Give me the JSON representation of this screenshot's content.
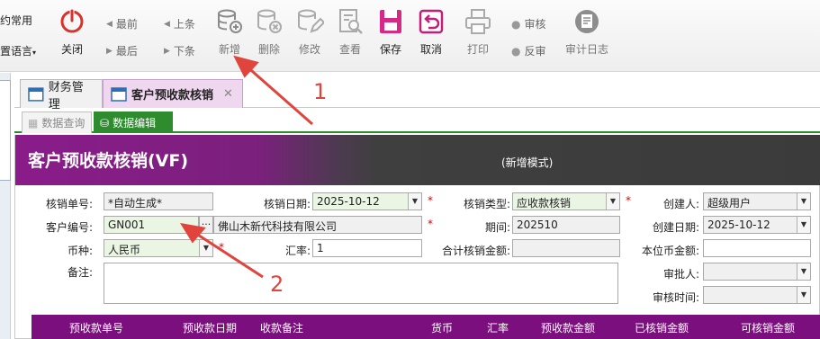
{
  "toolbar": {
    "left_line1": "约常用",
    "left_line2": "置语言",
    "left_line2_arrow": "▾",
    "close_label": "关闭",
    "first_label": "最前",
    "prev_label": "上条",
    "last_label": "最后",
    "next_label": "下条",
    "add_label": "新增",
    "delete_label": "删除",
    "edit_label": "修改",
    "view_label": "查看",
    "save_label": "保存",
    "cancel_label": "取消",
    "print_label": "打印",
    "audit_label": "审核",
    "unaudit_label": "反审",
    "auditlog_label": "审计日志"
  },
  "tabs": [
    {
      "label": "财务管理",
      "close": ""
    },
    {
      "label": "客户预收款核销",
      "close": "✕"
    }
  ],
  "subtabs": [
    {
      "label": "数据查询"
    },
    {
      "label": "数据编辑"
    }
  ],
  "form": {
    "title": "客户预收款核销(VF)",
    "mode": "(新增模式)",
    "doc_no_label": "核销单号:",
    "doc_no_value": "*自动生成*",
    "date_label": "核销日期:",
    "date_value": "2025-10-12",
    "type_label": "核销类型:",
    "type_value": "应收款核销",
    "creator_label": "创建人:",
    "creator_value": "超级用户",
    "customer_label": "客户编号:",
    "customer_value": "GN001",
    "customer_dots": "···",
    "customer_name": "佛山木新代科技有限公司",
    "period_label": "期间:",
    "period_value": "202510",
    "created_label": "创建日期:",
    "created_value": "2025-10-12",
    "currency_label": "币种:",
    "currency_value": "人民币",
    "rate_label": "汇率:",
    "rate_value": "1",
    "total_label": "合计核销金额:",
    "total_value": "",
    "local_total_label": "本位币金额:",
    "local_total_value": "",
    "remark_label": "备注:",
    "remark_value": "",
    "approver_label": "审批人:",
    "approver_value": "",
    "audit_time_label": "审核时间:",
    "audit_time_value": "",
    "required_mark": "*"
  },
  "grid": {
    "columns": [
      "预收款单号",
      "预收款日期",
      "收款备注",
      "货币",
      "汇率",
      "预收款金额",
      "已核销金额",
      "可核销金额"
    ]
  },
  "annotations": {
    "one": "1",
    "two": "2"
  },
  "colors": {
    "accent": "#7b0f7e",
    "tab_active": "#f0d7f0",
    "green": "#2e8b2e",
    "annotation": "#e0443c"
  }
}
